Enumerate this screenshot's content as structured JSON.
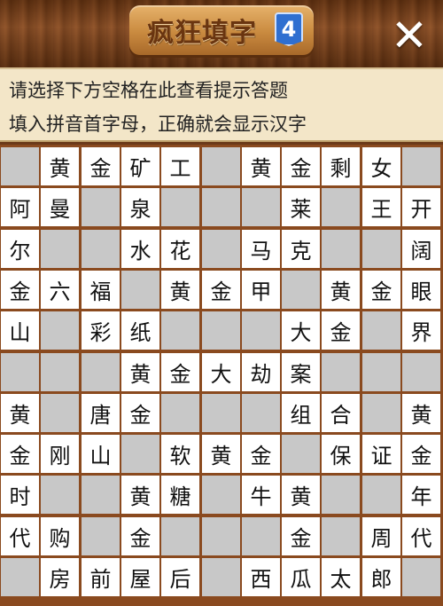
{
  "header": {
    "title": "疯狂填字",
    "badge": "4",
    "close_label": "✕"
  },
  "hint": {
    "line1": "请选择下方空格在此查看提示答题",
    "line2": "填入拼音首字母，正确就会显示汉字"
  },
  "grid": {
    "cols": 11,
    "rows": 11,
    "cells": [
      [
        "",
        "黄",
        "金",
        "矿",
        "工",
        "",
        "黄",
        "金",
        "剩",
        "女",
        ""
      ],
      [
        "阿",
        "曼",
        "",
        "泉",
        "",
        "",
        "",
        "莱",
        "",
        "王",
        "开"
      ],
      [
        "尔",
        "",
        "",
        "水",
        "花",
        "",
        "马",
        "克",
        "",
        "",
        "阔"
      ],
      [
        "金",
        "六",
        "福",
        "",
        "黄",
        "金",
        "甲",
        "",
        "黄",
        "金",
        "眼"
      ],
      [
        "山",
        "",
        "彩",
        "纸",
        "",
        "",
        "",
        "大",
        "金",
        "",
        "界"
      ],
      [
        "",
        "",
        "",
        "黄",
        "金",
        "大",
        "劫",
        "案",
        "",
        "",
        ""
      ],
      [
        "黄",
        "",
        "唐",
        "金",
        "",
        "",
        "",
        "组",
        "合",
        "",
        "黄"
      ],
      [
        "金",
        "刚",
        "山",
        "",
        "软",
        "黄",
        "金",
        "",
        "保",
        "证",
        "金"
      ],
      [
        "时",
        "",
        "",
        "黄",
        "糖",
        "",
        "牛",
        "黄",
        "",
        "",
        "年"
      ],
      [
        "代",
        "购",
        "",
        "金",
        "",
        "",
        "",
        "金",
        "",
        "周",
        "代"
      ],
      [
        "",
        "房",
        "前",
        "屋",
        "后",
        "",
        "西",
        "瓜",
        "太",
        "郎",
        ""
      ]
    ]
  }
}
